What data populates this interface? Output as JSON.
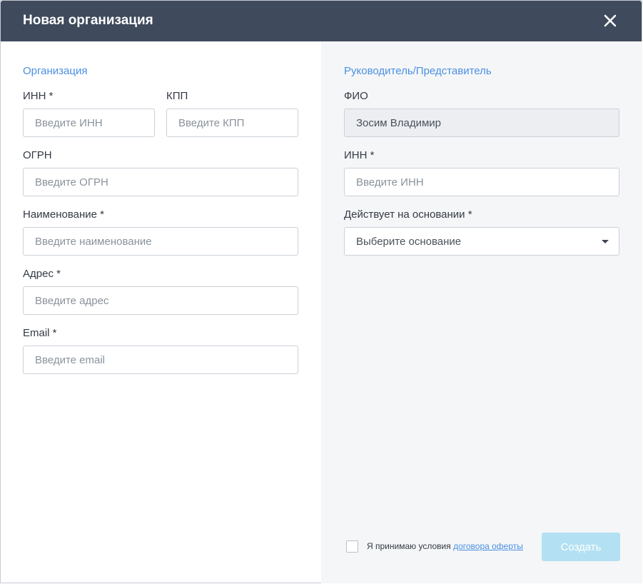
{
  "dialog": {
    "title": "Новая организация"
  },
  "organization": {
    "section_title": "Организация",
    "inn": {
      "label": "ИНН *",
      "placeholder": "Введите ИНН",
      "value": ""
    },
    "kpp": {
      "label": "КПП",
      "placeholder": "Введите КПП",
      "value": ""
    },
    "ogrn": {
      "label": "ОГРН",
      "placeholder": "Введите ОГРН",
      "value": ""
    },
    "name": {
      "label": "Наименование *",
      "placeholder": "Введите наименование",
      "value": ""
    },
    "address": {
      "label": "Адрес *",
      "placeholder": "Введите адрес",
      "value": ""
    },
    "email": {
      "label": "Email *",
      "placeholder": "Введите email",
      "value": ""
    }
  },
  "representative": {
    "section_title": "Руководитель/Представитель",
    "fio": {
      "label": "ФИО",
      "value": "Зосим Владимир"
    },
    "inn": {
      "label": "ИНН *",
      "placeholder": "Введите ИНН",
      "value": ""
    },
    "basis": {
      "label": "Действует на основании *",
      "selected": "Выберите основание"
    }
  },
  "footer": {
    "agree_text": "Я принимаю условия ",
    "agree_link": "договора оферты",
    "agree_checked": false,
    "create_label": "Создать"
  },
  "colors": {
    "header_bg": "#3f4a5c",
    "accent": "#4a90e2",
    "create_button_disabled": "#b3e1f3",
    "right_panel_bg": "#f5f6f8"
  },
  "icons": {
    "close": "close-icon",
    "dropdown": "chevron-down-icon"
  }
}
